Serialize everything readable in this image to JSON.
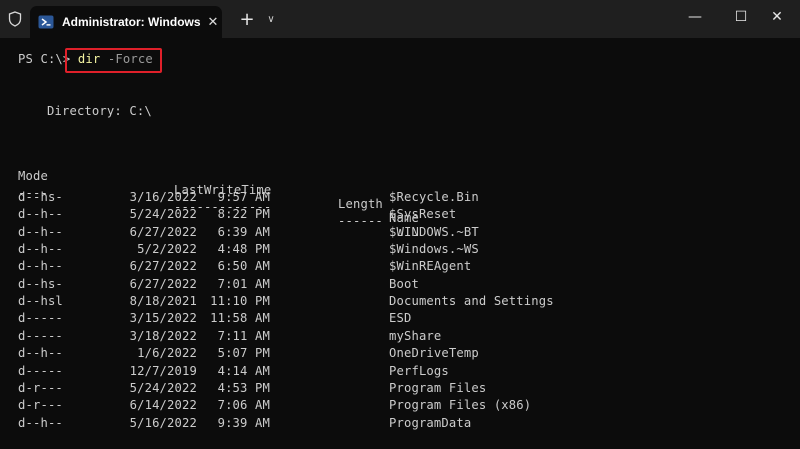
{
  "window": {
    "tab_title": "Administrator: Windows Powe",
    "tab_close": "✕",
    "new_tab": "+",
    "tab_menu": "∨",
    "minimize": "—",
    "maximize": "☐",
    "close": "✕"
  },
  "terminal": {
    "prompt": "PS C:\\>",
    "command": "dir",
    "parameter": "-Force",
    "directory_label": "Directory: C:\\",
    "headers": {
      "mode": "Mode",
      "lastwrite": "LastWriteTime",
      "length": "Length",
      "name": "Name"
    },
    "underlines": {
      "mode": "----",
      "lastwrite": "-------------",
      "length": "------",
      "name": "----"
    },
    "rows": [
      {
        "mode": "d--hs-",
        "date": "3/16/2022",
        "time": "9:57 AM",
        "name": "$Recycle.Bin"
      },
      {
        "mode": "d--h--",
        "date": "5/24/2022",
        "time": "8:22 PM",
        "name": "$SysReset"
      },
      {
        "mode": "d--h--",
        "date": "6/27/2022",
        "time": "6:39 AM",
        "name": "$WINDOWS.~BT"
      },
      {
        "mode": "d--h--",
        "date": "5/2/2022",
        "time": "4:48 PM",
        "name": "$Windows.~WS"
      },
      {
        "mode": "d--h--",
        "date": "6/27/2022",
        "time": "6:50 AM",
        "name": "$WinREAgent"
      },
      {
        "mode": "d--hs-",
        "date": "6/27/2022",
        "time": "7:01 AM",
        "name": "Boot"
      },
      {
        "mode": "d--hsl",
        "date": "8/18/2021",
        "time": "11:10 PM",
        "name": "Documents and Settings"
      },
      {
        "mode": "d-----",
        "date": "3/15/2022",
        "time": "11:58 AM",
        "name": "ESD"
      },
      {
        "mode": "d-----",
        "date": "3/18/2022",
        "time": "7:11 AM",
        "name": "myShare"
      },
      {
        "mode": "d--h--",
        "date": "1/6/2022",
        "time": "5:07 PM",
        "name": "OneDriveTemp"
      },
      {
        "mode": "d-----",
        "date": "12/7/2019",
        "time": "4:14 AM",
        "name": "PerfLogs"
      },
      {
        "mode": "d-r---",
        "date": "5/24/2022",
        "time": "4:53 PM",
        "name": "Program Files"
      },
      {
        "mode": "d-r---",
        "date": "6/14/2022",
        "time": "7:06 AM",
        "name": "Program Files (x86)"
      },
      {
        "mode": "d--h--",
        "date": "5/16/2022",
        "time": "9:39 AM",
        "name": "ProgramData"
      }
    ]
  },
  "colors": {
    "background": "#0c0c0c",
    "titlebar": "#1f1f1f",
    "text": "#cccccc",
    "command": "#f2f2a0",
    "parameter": "#9a9a9a",
    "highlight": "#e0202a"
  }
}
